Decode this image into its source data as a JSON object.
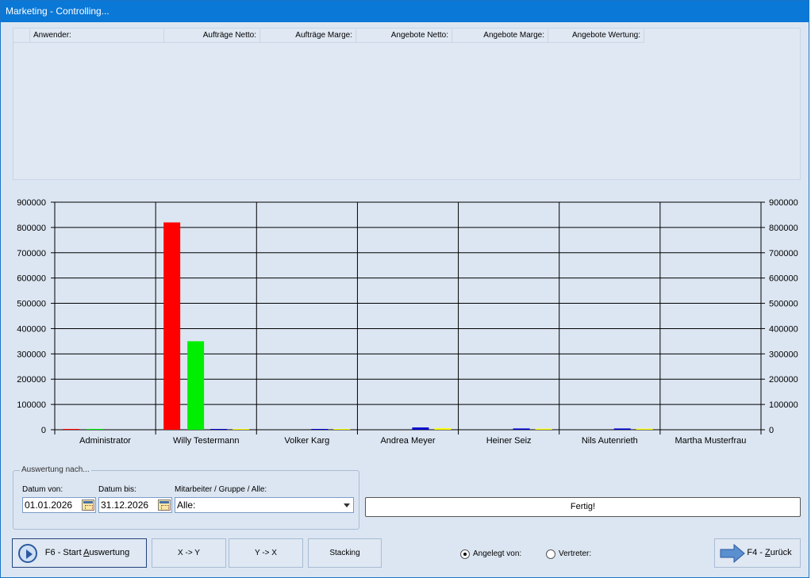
{
  "window": {
    "title": "Marketing - Controlling..."
  },
  "grid": {
    "columns": [
      "Anwender:",
      "Aufträge Netto:",
      "Aufträge Marge:",
      "Angebote Netto:",
      "Angebote Marge:",
      "Angebote Wertung:"
    ]
  },
  "chart_data": {
    "type": "bar",
    "categories": [
      "Administrator",
      "Willy Testermann",
      "Volker Karg",
      "Andrea Meyer",
      "Heiner Seiz",
      "Nils Autenrieth",
      "Martha Musterfrau"
    ],
    "series": [
      {
        "color": "#ff0000",
        "values": [
          3000,
          820000,
          0,
          0,
          0,
          0,
          0
        ]
      },
      {
        "color": "#00ee00",
        "values": [
          3000,
          350000,
          0,
          0,
          0,
          0,
          0
        ]
      },
      {
        "color": "#0000cc",
        "values": [
          0,
          2500,
          3000,
          9000,
          5000,
          5000,
          0
        ]
      },
      {
        "color": "#ffff00",
        "values": [
          0,
          1500,
          1500,
          6000,
          4000,
          4000,
          0
        ]
      }
    ],
    "ylim": [
      0,
      900000
    ],
    "yticks": [
      "0",
      "100000",
      "200000",
      "300000",
      "400000",
      "500000",
      "600000",
      "700000",
      "800000",
      "900000"
    ],
    "grid": true
  },
  "filter": {
    "legend": "Auswertung nach...",
    "date_from_label": "Datum von:",
    "date_from": "01.01.2026",
    "date_to_label": "Datum bis:",
    "date_to": "31.12.2026",
    "employee_label": "Mitarbeiter / Gruppe / Alle:",
    "employee_value": "Alle:"
  },
  "status": {
    "text": "Fertig!"
  },
  "buttons": {
    "start_prefix": "F6 - Start ",
    "start_underlined": "A",
    "start_suffix": "uswertung",
    "x_to_y": "X -> Y",
    "y_to_x": "Y -> X",
    "stacking": "Stacking",
    "back_prefix": "F4 - ",
    "back_underlined": "Z",
    "back_suffix": "urück"
  },
  "radio": {
    "created_by": "Angelegt von:",
    "representative": "Vertreter:",
    "selected": "created_by"
  }
}
